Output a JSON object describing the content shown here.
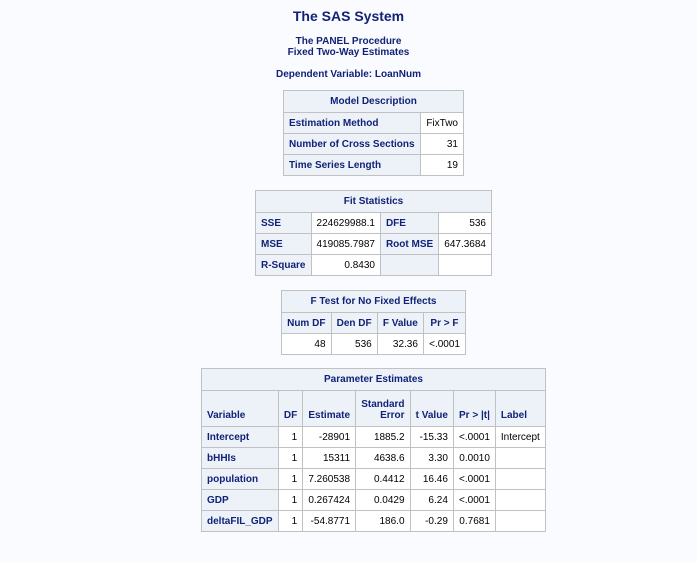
{
  "titles": {
    "system": "The SAS System",
    "procedure": "The PANEL Procedure",
    "subtitle": "Fixed Two-Way Estimates",
    "dependent": "Dependent Variable: LoanNum"
  },
  "model_description": {
    "caption": "Model Description",
    "rows": [
      {
        "label": "Estimation Method",
        "value": "FixTwo"
      },
      {
        "label": "Number of Cross Sections",
        "value": "31"
      },
      {
        "label": "Time Series Length",
        "value": "19"
      }
    ]
  },
  "fit_statistics": {
    "caption": "Fit Statistics",
    "rows": [
      {
        "l1": "SSE",
        "v1": "224629988.1",
        "l2": "DFE",
        "v2": "536"
      },
      {
        "l1": "MSE",
        "v1": "419085.7987",
        "l2": "Root MSE",
        "v2": "647.3684"
      },
      {
        "l1": "R-Square",
        "v1": "0.8430",
        "l2": "",
        "v2": ""
      }
    ]
  },
  "f_test": {
    "caption": "F Test for No Fixed Effects",
    "headers": [
      "Num DF",
      "Den DF",
      "F Value",
      "Pr > F"
    ],
    "row": [
      "48",
      "536",
      "32.36",
      "<.0001"
    ]
  },
  "parameter_estimates": {
    "caption": "Parameter Estimates",
    "headers": {
      "variable": "Variable",
      "df": "DF",
      "estimate": "Estimate",
      "stderr_line1": "Standard",
      "stderr_line2": "Error",
      "tvalue": "t Value",
      "prob": "Pr > |t|",
      "label": "Label"
    },
    "rows": [
      {
        "variable": "Intercept",
        "df": "1",
        "estimate": "-28901",
        "stderr": "1885.2",
        "t": "-15.33",
        "p": "<.0001",
        "label": "Intercept"
      },
      {
        "variable": "bHHIs",
        "df": "1",
        "estimate": "15311",
        "stderr": "4638.6",
        "t": "3.30",
        "p": "0.0010",
        "label": ""
      },
      {
        "variable": "population",
        "df": "1",
        "estimate": "7.260538",
        "stderr": "0.4412",
        "t": "16.46",
        "p": "<.0001",
        "label": ""
      },
      {
        "variable": "GDP",
        "df": "1",
        "estimate": "0.267424",
        "stderr": "0.0429",
        "t": "6.24",
        "p": "<.0001",
        "label": ""
      },
      {
        "variable": "deltaFIL_GDP",
        "df": "1",
        "estimate": "-54.8771",
        "stderr": "186.0",
        "t": "-0.29",
        "p": "0.7681",
        "label": ""
      }
    ]
  }
}
